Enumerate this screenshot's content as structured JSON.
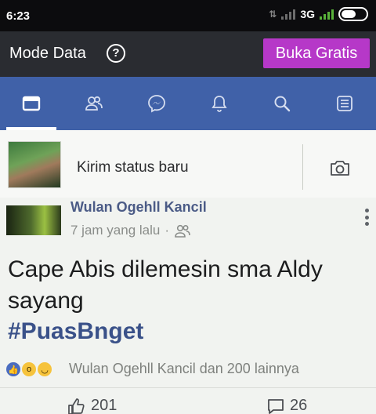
{
  "status_bar": {
    "time": "6:23",
    "network": "3G"
  },
  "mode_bar": {
    "label": "Mode Data",
    "help_icon": "question-circle-icon",
    "free_button": "Buka Gratis"
  },
  "nav": {
    "items": [
      {
        "icon": "news-feed-icon",
        "active": true
      },
      {
        "icon": "friends-icon",
        "active": false
      },
      {
        "icon": "messenger-icon",
        "active": false
      },
      {
        "icon": "bell-icon",
        "active": false
      },
      {
        "icon": "search-icon",
        "active": false
      },
      {
        "icon": "menu-icon",
        "active": false
      }
    ]
  },
  "composer": {
    "placeholder": "Kirim status baru",
    "camera_icon": "camera-icon"
  },
  "post": {
    "author": "Wulan Ogehll Kancil",
    "time": "7 jam yang lalu",
    "separator": "·",
    "privacy_icon": "friends-icon",
    "text": "Cape Abis dilemesin sma Aldy sayang",
    "hashtag": "#PuasBnget",
    "reaction_summary": "Wulan Ogehll Kancil dan 200 lainnya",
    "reactions": [
      "like",
      "wow",
      "haha"
    ],
    "like_count": "201",
    "comment_count": "26"
  },
  "colors": {
    "nav_bg": "#4061a8",
    "free_button_bg": "#b638c8",
    "author": "#4b5b86",
    "hashtag": "#3a5189"
  }
}
